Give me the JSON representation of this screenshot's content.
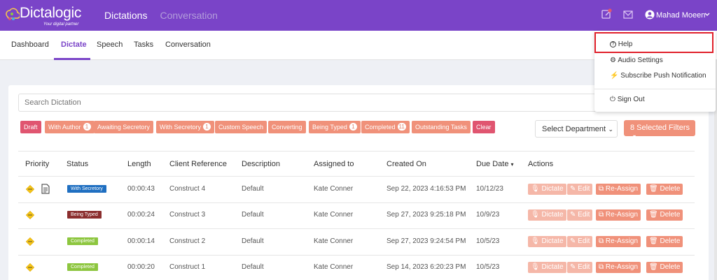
{
  "brand": {
    "name": "Dictalogic",
    "tagline": "Your digital partner"
  },
  "top_nav": {
    "dictations": "Dictations",
    "conversation": "Conversation"
  },
  "user": {
    "name": "Mahad Moeen"
  },
  "sub_nav": [
    "Dashboard",
    "Dictate",
    "Speech",
    "Tasks",
    "Conversation"
  ],
  "search": {
    "placeholder": "Search Dictation"
  },
  "filters": [
    {
      "label": "Draft",
      "count": null
    },
    {
      "label": "With Author",
      "count": "1"
    },
    {
      "label": "Awaiting Secretory",
      "count": null
    },
    {
      "label": "With Secretory",
      "count": "1"
    },
    {
      "label": "Custom Speech",
      "count": null
    },
    {
      "label": "Converting",
      "count": null
    },
    {
      "label": "Being Typed",
      "count": "1"
    },
    {
      "label": "Completed",
      "count": "11"
    },
    {
      "label": "Outstanding Tasks",
      "count": null
    },
    {
      "label": "Clear",
      "count": null
    }
  ],
  "department": {
    "value": "Select Department"
  },
  "selected_filters": "8 Selected Filters",
  "table": {
    "headers": [
      "Priority",
      "Status",
      "Length",
      "Client Reference",
      "Description",
      "Assigned to",
      "Created On",
      "Due Date",
      "Actions"
    ],
    "rows": [
      {
        "status": "With Secretory",
        "status_color": "#1f6fc1",
        "length": "00:00:43",
        "client": "Construct 4",
        "description": "Default",
        "assigned": "Kate Conner",
        "created": "Sep 22, 2023 4:16:53 PM",
        "due": "10/12/23"
      },
      {
        "status": "Being Typed",
        "status_color": "#8b2e2e",
        "length": "00:00:24",
        "client": "Construct 3",
        "description": "Default",
        "assigned": "Kate Conner",
        "created": "Sep 27, 2023 9:25:18 PM",
        "due": "10/9/23"
      },
      {
        "status": "Completed",
        "status_color": "#8dc63f",
        "length": "00:00:14",
        "client": "Construct 2",
        "description": "Default",
        "assigned": "Kate Conner",
        "created": "Sep 27, 2023 9:24:54 PM",
        "due": "10/5/23"
      },
      {
        "status": "Completed",
        "status_color": "#8dc63f",
        "length": "00:00:20",
        "client": "Construct 1",
        "description": "Default",
        "assigned": "Kate Conner",
        "created": "Sep 14, 2023 6:20:23 PM",
        "due": "10/5/23"
      }
    ],
    "actions": {
      "dictate": "Dictate",
      "edit": "Edit",
      "reassign": "Re-Assign",
      "delete": "Delete"
    }
  },
  "user_menu": {
    "help": "Help",
    "audio": "Audio Settings",
    "push": "Subscribe Push Notification",
    "signout": "Sign Out"
  },
  "colors": {
    "brand": "#7a44c8",
    "accent": "#f0917a",
    "highlight": "#e0202a"
  }
}
